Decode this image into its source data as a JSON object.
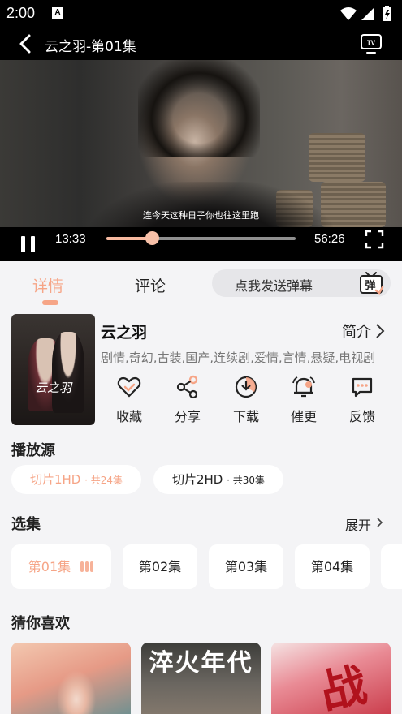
{
  "status_bar": {
    "time": "2:00",
    "notification_icon": "A"
  },
  "player": {
    "title": "云之羽-第01集",
    "subtitle": "连今天这种日子你也往这里跑",
    "current_time": "13:33",
    "total_time": "56:26",
    "progress_fraction": 0.24,
    "icons": [
      "back-icon",
      "tv-cast-icon",
      "pause-icon",
      "fullscreen-icon"
    ]
  },
  "tabs": [
    {
      "label": "详情",
      "active": true
    },
    {
      "label": "评论",
      "active": false
    }
  ],
  "danmaku": {
    "placeholder": "点我发送弹幕",
    "icon_text": "弹"
  },
  "show": {
    "poster_title": "云之羽",
    "title": "云之羽",
    "intro_label": "简介",
    "tags": "剧情,奇幻,古装,国产,连续剧,爱情,言情,悬疑,电视剧"
  },
  "actions": [
    {
      "label": "收藏",
      "icon": "heart-icon"
    },
    {
      "label": "分享",
      "icon": "share-icon"
    },
    {
      "label": "下载",
      "icon": "download-icon"
    },
    {
      "label": "催更",
      "icon": "bell-icon"
    },
    {
      "label": "反馈",
      "icon": "feedback-icon"
    }
  ],
  "sources": {
    "title": "播放源",
    "items": [
      {
        "label": "切片1HD",
        "count": "· 共24集",
        "active": true
      },
      {
        "label": "切片2HD",
        "count": "· 共30集",
        "active": false
      }
    ]
  },
  "episodes": {
    "title": "选集",
    "expand_label": "展开",
    "items": [
      {
        "label": "第01集",
        "active": true
      },
      {
        "label": "第02集",
        "active": false
      },
      {
        "label": "第03集",
        "active": false
      },
      {
        "label": "第04集",
        "active": false
      }
    ]
  },
  "recommend": {
    "title": "猜你喜欢",
    "items": [
      {
        "title_text": ""
      },
      {
        "title_text": "淬火年代"
      },
      {
        "title_text": "战"
      }
    ]
  },
  "colors": {
    "accent": "#f6a587",
    "background": "#f4f4f6"
  }
}
